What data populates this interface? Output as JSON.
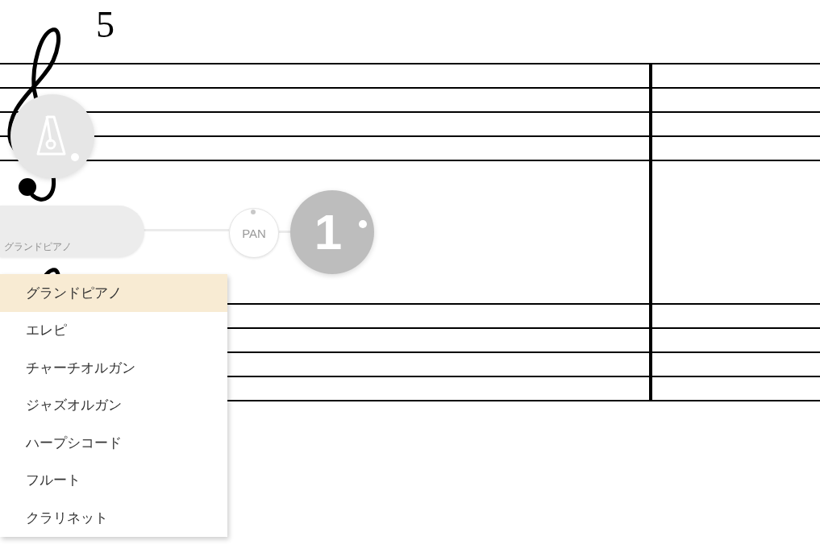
{
  "score": {
    "measure_number": "5"
  },
  "track": {
    "instrument": "グランドピアノ",
    "pan": {
      "label": "PAN"
    },
    "channel": "1"
  },
  "instrument_menu": {
    "items": [
      {
        "label": "グランドピアノ",
        "selected": true
      },
      {
        "label": "エレピ",
        "selected": false
      },
      {
        "label": "チャーチオルガン",
        "selected": false
      },
      {
        "label": "ジャズオルガン",
        "selected": false
      },
      {
        "label": "ハープシコード",
        "selected": false
      },
      {
        "label": "フルート",
        "selected": false
      },
      {
        "label": "クラリネット",
        "selected": false
      }
    ]
  }
}
